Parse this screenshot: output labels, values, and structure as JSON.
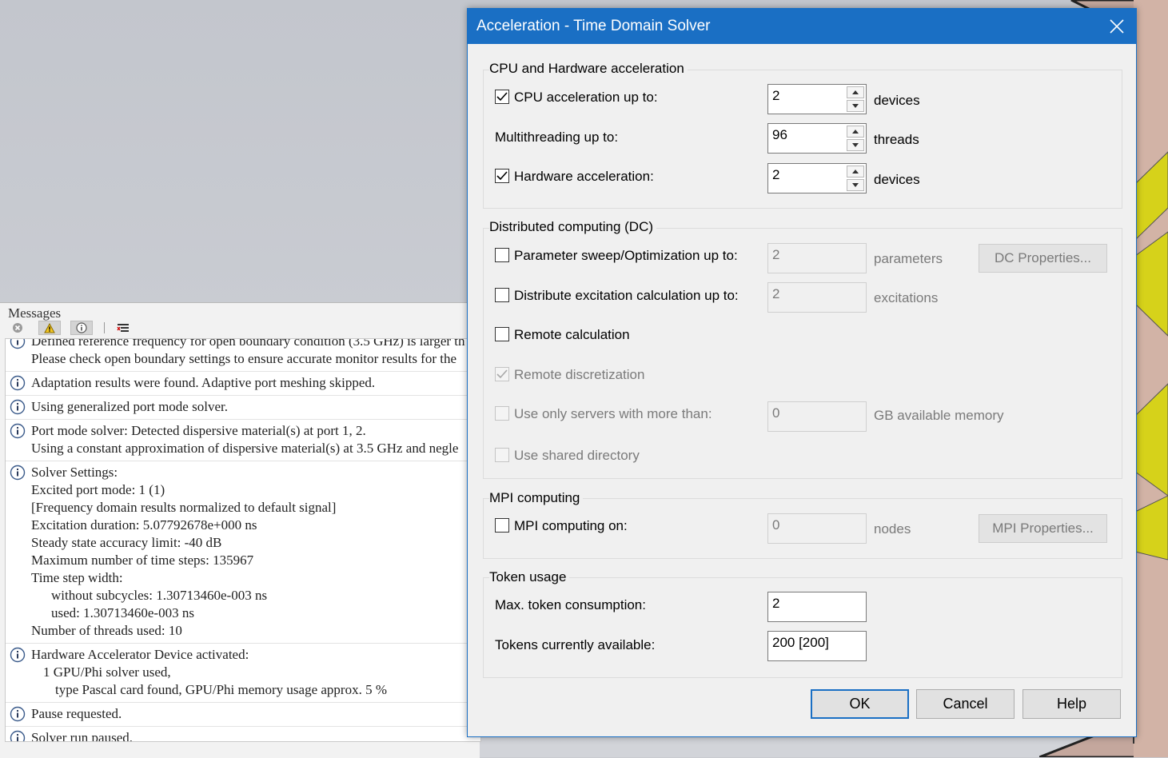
{
  "messages": {
    "title": "Messages",
    "items": [
      {
        "lines": [
          "Defined reference frequency for open boundary condition (3.5 GHz) is larger th",
          "Please check open boundary settings to ensure accurate monitor results for the"
        ]
      },
      {
        "lines": [
          "Adaptation results were found. Adaptive port meshing skipped."
        ]
      },
      {
        "lines": [
          "Using generalized port mode solver."
        ]
      },
      {
        "lines": [
          "Port mode solver: Detected dispersive material(s) at port 1, 2.",
          "Using a constant approximation of dispersive material(s) at 3.5 GHz and negle"
        ]
      },
      {
        "lines": [
          "Solver Settings:",
          "Excited port mode: 1 (1)",
          "[Frequency domain results normalized to default signal]",
          "Excitation duration: 5.07792678e+000 ns",
          "Steady state accuracy limit: -40 dB",
          "Maximum number of time steps: 135967",
          "Time step width:",
          "without subcycles: 1.30713460e-003 ns",
          "used: 1.30713460e-003 ns",
          "Number of threads used: 10"
        ]
      },
      {
        "lines": [
          "Hardware Accelerator Device activated:",
          "1 GPU/Phi solver used,",
          "type Pascal card found, GPU/Phi memory usage approx. 5 %"
        ]
      },
      {
        "lines": [
          "Pause requested."
        ]
      },
      {
        "lines": [
          "Solver run paused."
        ]
      }
    ]
  },
  "dialog": {
    "title": "Acceleration - Time Domain Solver",
    "cpu_group": {
      "label": "CPU and Hardware acceleration",
      "cpu_accel": {
        "label": "CPU acceleration up to:",
        "checked": true,
        "value": "2",
        "unit": "devices"
      },
      "multithreading": {
        "label": "Multithreading up to:",
        "value": "96",
        "unit": "threads"
      },
      "hw_accel": {
        "label": "Hardware acceleration:",
        "checked": true,
        "value": "2",
        "unit": "devices"
      }
    },
    "dc_group": {
      "label": "Distributed computing (DC)",
      "param_sweep": {
        "label": "Parameter sweep/Optimization up to:",
        "checked": false,
        "value": "2",
        "unit": "parameters"
      },
      "dc_properties_button": "DC Properties...",
      "distribute_excitation": {
        "label": "Distribute excitation calculation up to:",
        "checked": false,
        "value": "2",
        "unit": "excitations"
      },
      "remote_calc": {
        "label": "Remote calculation",
        "checked": false
      },
      "remote_disc": {
        "label": "Remote discretization",
        "checked": true
      },
      "servers_memory": {
        "label": "Use only servers with more than:",
        "checked": false,
        "value": "0",
        "unit": "GB available memory"
      },
      "shared_dir": {
        "label": "Use shared directory",
        "checked": false
      }
    },
    "mpi_group": {
      "label": "MPI computing",
      "mpi_on": {
        "label": "MPI computing on:",
        "checked": false,
        "value": "0",
        "unit": "nodes"
      },
      "mpi_properties_button": "MPI Properties..."
    },
    "token_group": {
      "label": "Token usage",
      "max_tokens": {
        "label": "Max. token consumption:",
        "value": "2"
      },
      "available_tokens": {
        "label": "Tokens currently available:",
        "value": "200 [200]"
      }
    },
    "buttons": {
      "ok": "OK",
      "cancel": "Cancel",
      "help": "Help"
    }
  },
  "colors": {
    "titlebar": "#1a6fc4",
    "background_shape": "#d4b4a8",
    "accent_yellow": "#d6d21a"
  }
}
